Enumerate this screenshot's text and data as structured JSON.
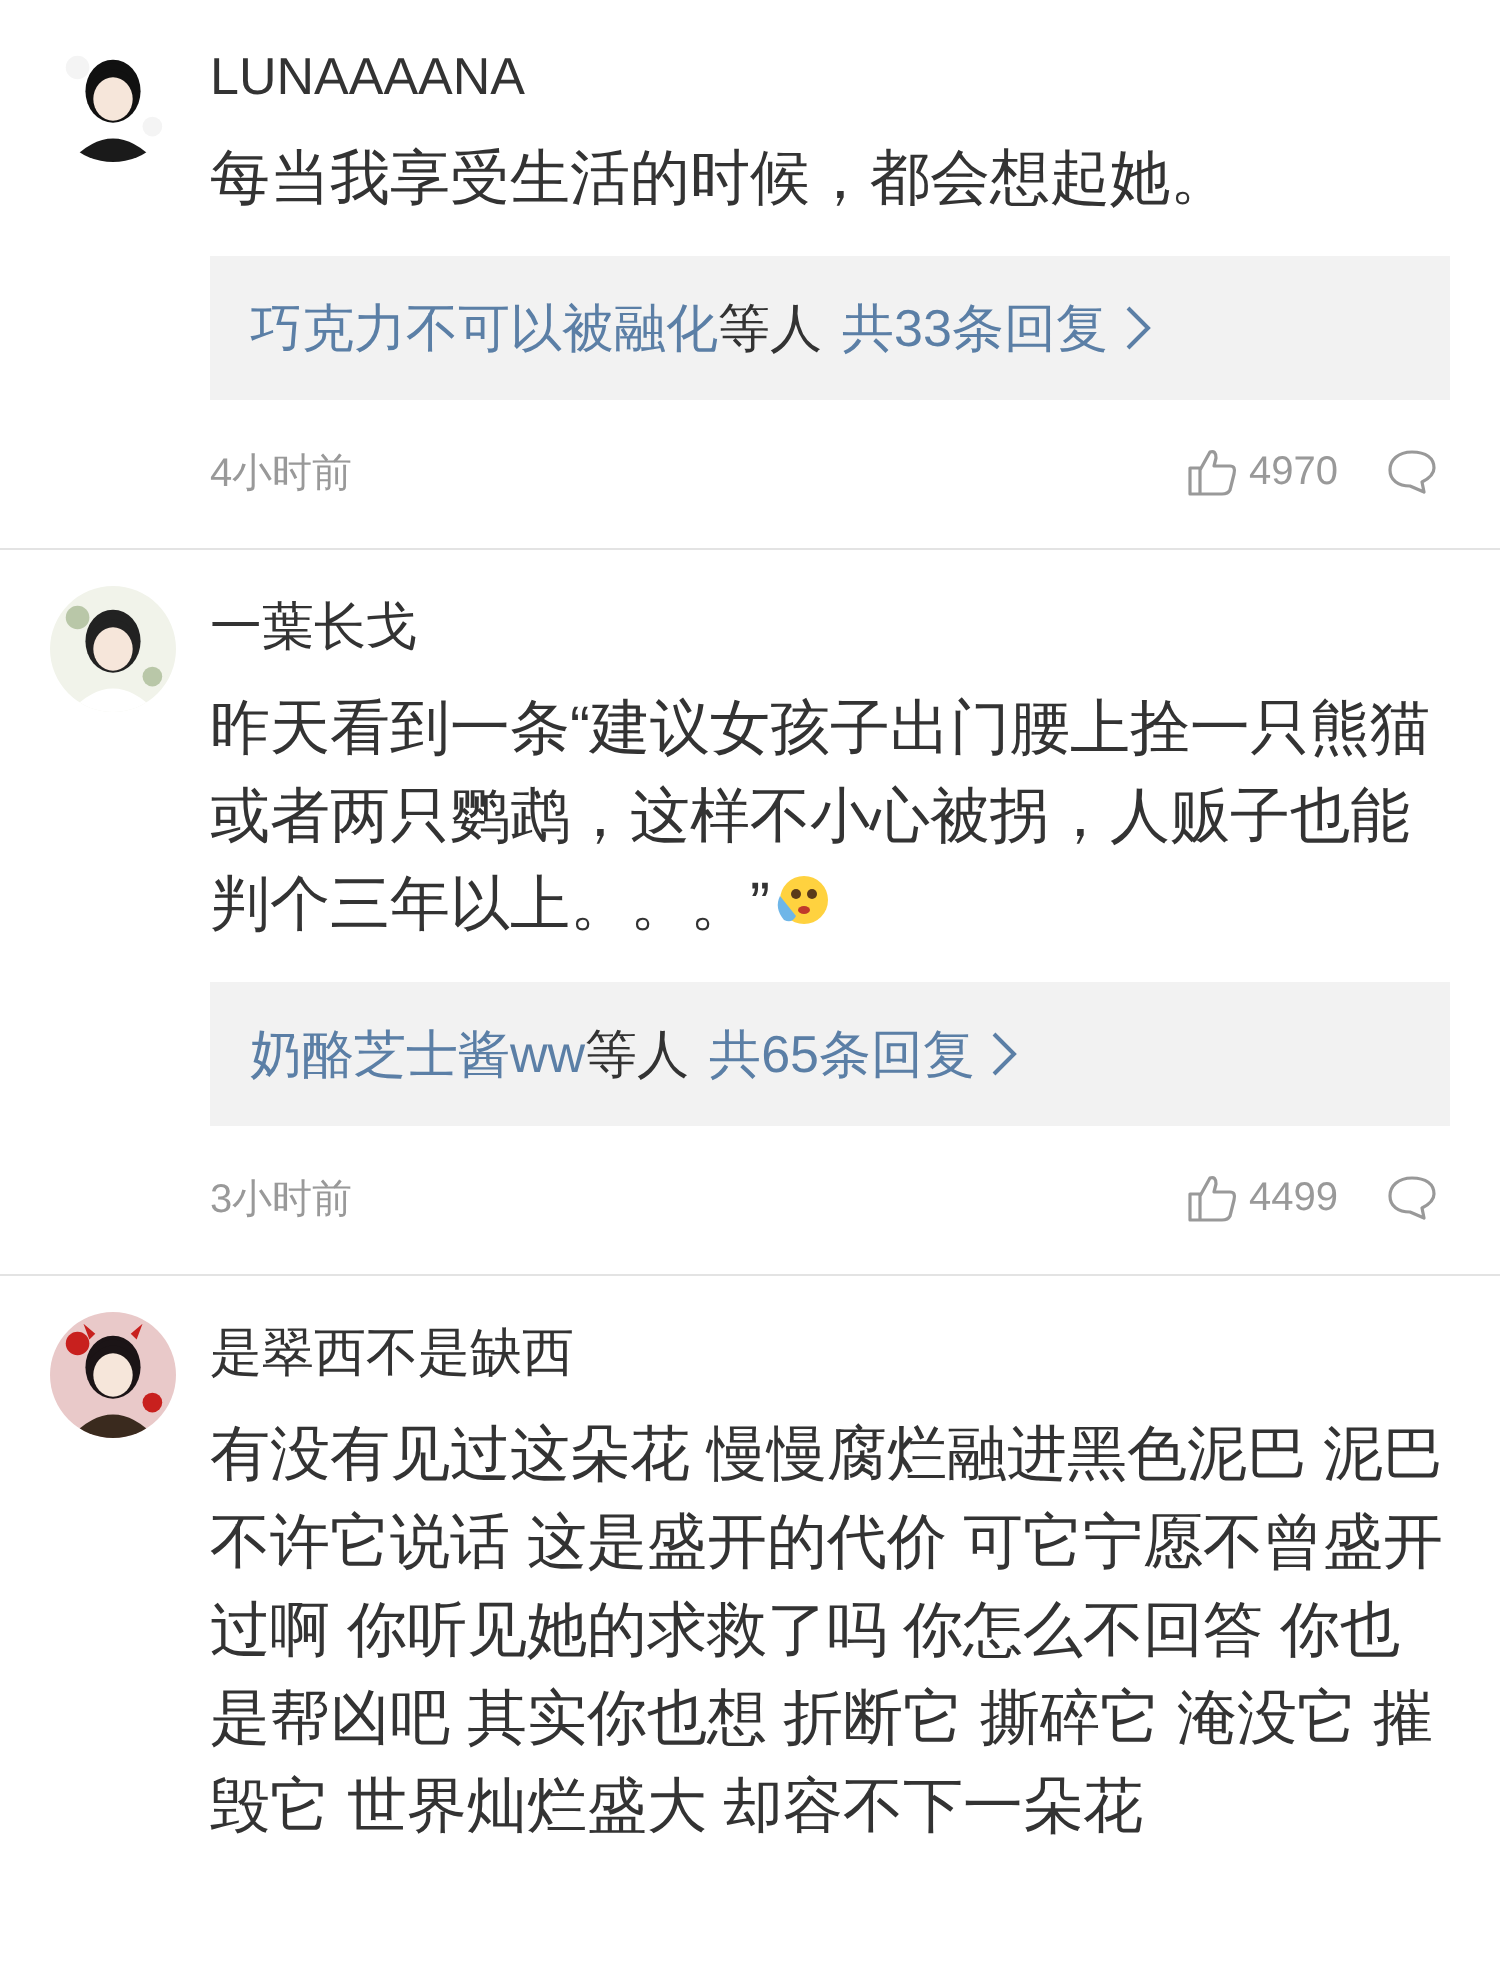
{
  "comments": [
    {
      "username": "LUNAAAANA",
      "text": "每当我享受生活的时候，都会想起她。",
      "trailing_emoji": false,
      "replies": {
        "author": "巧克力不可以被融化",
        "suffix": "等人",
        "count": "共33条回复"
      },
      "time": "4小时前",
      "likes": "4970"
    },
    {
      "username": "一葉长戈",
      "text": "昨天看到一条“建议女孩子出门腰上拴一只熊猫或者两只鹦鹉，这样不小心被拐，人贩子也能判个三年以上。。。”",
      "trailing_emoji": true,
      "replies": {
        "author": "奶酪芝士酱ww",
        "suffix": "等人",
        "count": "共65条回复"
      },
      "time": "3小时前",
      "likes": "4499"
    },
    {
      "username": "是翠西不是缺西",
      "text": "有没有见过这朵花 慢慢腐烂融进黑色泥巴 泥巴不许它说话 这是盛开的代价 可它宁愿不曾盛开过啊 你听见她的求救了吗 你怎么不回答 你也是帮凶吧 其实你也想 折断它 撕碎它 淹没它 摧毁它 世界灿烂盛大 却容不下一朵花",
      "trailing_emoji": false
    }
  ]
}
